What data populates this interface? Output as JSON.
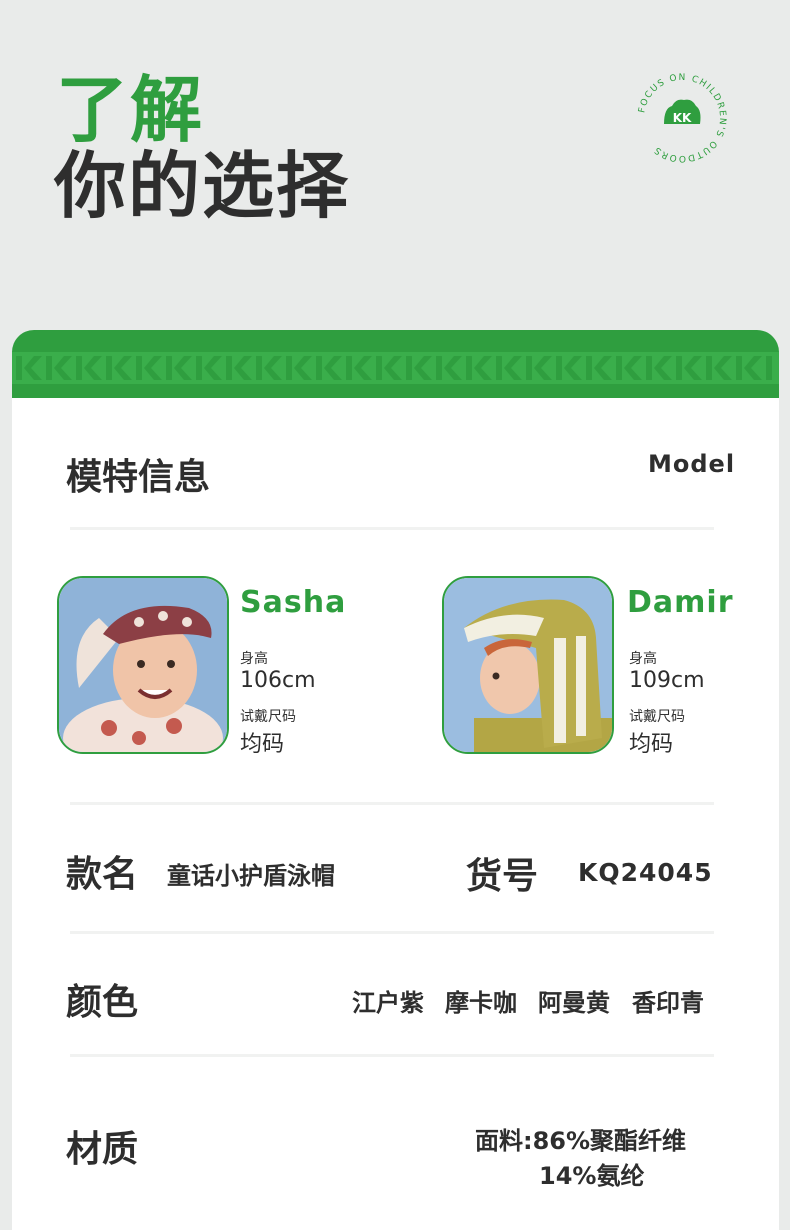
{
  "header": {
    "line1": "了解",
    "line2": "你的选择",
    "badge_text": "FOCUS ON CHILDREN'S OUTDOORS",
    "badge_logo": "KK"
  },
  "model_section": {
    "title": "模特信息",
    "english": "Model",
    "models": [
      {
        "name": "Sasha",
        "height_label": "身高",
        "height": "106cm",
        "size_label": "试戴尺码",
        "size": "均码"
      },
      {
        "name": "Damir",
        "height_label": "身高",
        "height": "109cm",
        "size_label": "试戴尺码",
        "size": "均码"
      }
    ]
  },
  "product": {
    "name_label": "款名",
    "name_value": "童话小护盾泳帽",
    "sku_label": "货号",
    "sku_value": "KQ24045"
  },
  "colors": {
    "label": "颜色",
    "items": [
      "江户紫",
      "摩卡咖",
      "阿曼黄",
      "香印青"
    ]
  },
  "material": {
    "label": "材质",
    "line1": "面料:86%聚酯纤维",
    "line2": "14%氨纶"
  },
  "theme": {
    "accent": "#2f9e3f",
    "text": "#2e2e2e",
    "background": "#e9ebea"
  }
}
